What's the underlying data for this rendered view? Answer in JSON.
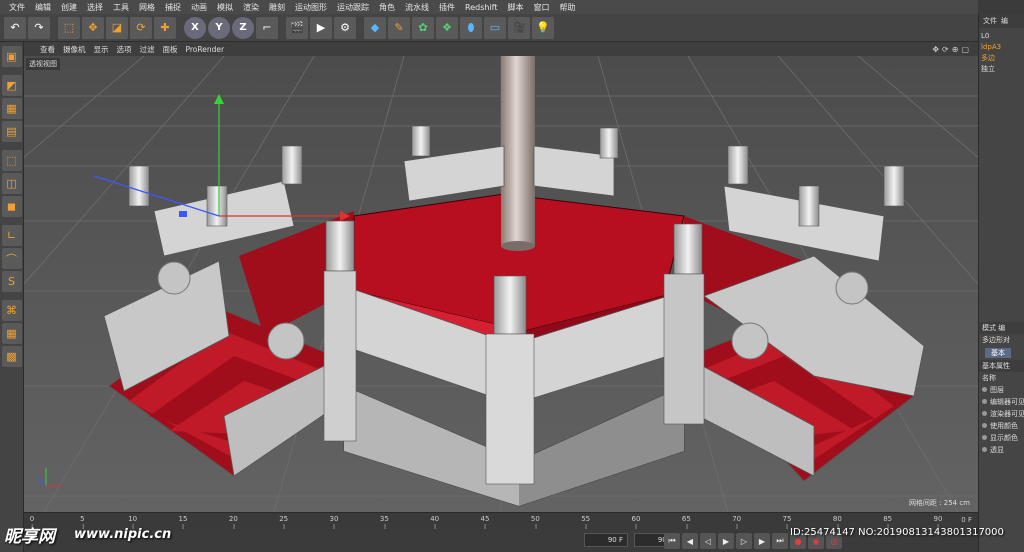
{
  "menu": [
    "文件",
    "编辑",
    "创建",
    "选择",
    "工具",
    "网格",
    "捕捉",
    "动画",
    "模拟",
    "渲染",
    "雕刻",
    "运动图形",
    "运动跟踪",
    "角色",
    "流水线",
    "插件",
    "Redshift",
    "脚本",
    "窗口",
    "帮助"
  ],
  "toolbar": {
    "undo_icon": "undo-icon",
    "axis": [
      "X",
      "Y",
      "Z"
    ]
  },
  "viewport_menu": [
    "查看",
    "摄像机",
    "显示",
    "选项",
    "过滤",
    "面板",
    "ProRender"
  ],
  "viewport": {
    "label": "透视视图",
    "grid_info": "网格间距 : 254 cm"
  },
  "timeline": {
    "ticks": [
      "0",
      "5",
      "10",
      "15",
      "20",
      "25",
      "30",
      "35",
      "40",
      "45",
      "50",
      "55",
      "60",
      "65",
      "70",
      "75",
      "80",
      "85",
      "90"
    ],
    "end_tag": "0 F"
  },
  "transport": {
    "start_frame": "90 F",
    "end_frame": "90 F"
  },
  "right_panel": {
    "tabs": [
      "文件",
      "编"
    ],
    "objects": [
      "L0 ",
      "ldpA3",
      "多边",
      "独立"
    ],
    "attr_tabs": [
      "模式",
      "编"
    ],
    "attr_obj": "多边形对",
    "basic_tab": "基本",
    "section": "基本属性",
    "fields": [
      "名称",
      "图层",
      "编辑器可见",
      "渲染器可见",
      "使用颜色",
      "显示颜色",
      "透显"
    ]
  },
  "watermark": {
    "logo": "昵享网",
    "url": "www.nipic.cn",
    "id": "ID:25474147 NO:20190813143801317000"
  },
  "colors": {
    "carpet": "#b01020",
    "marble": "#d8d8d8",
    "pillar": "#b8a8a0",
    "bg": "#5b5b5b"
  }
}
